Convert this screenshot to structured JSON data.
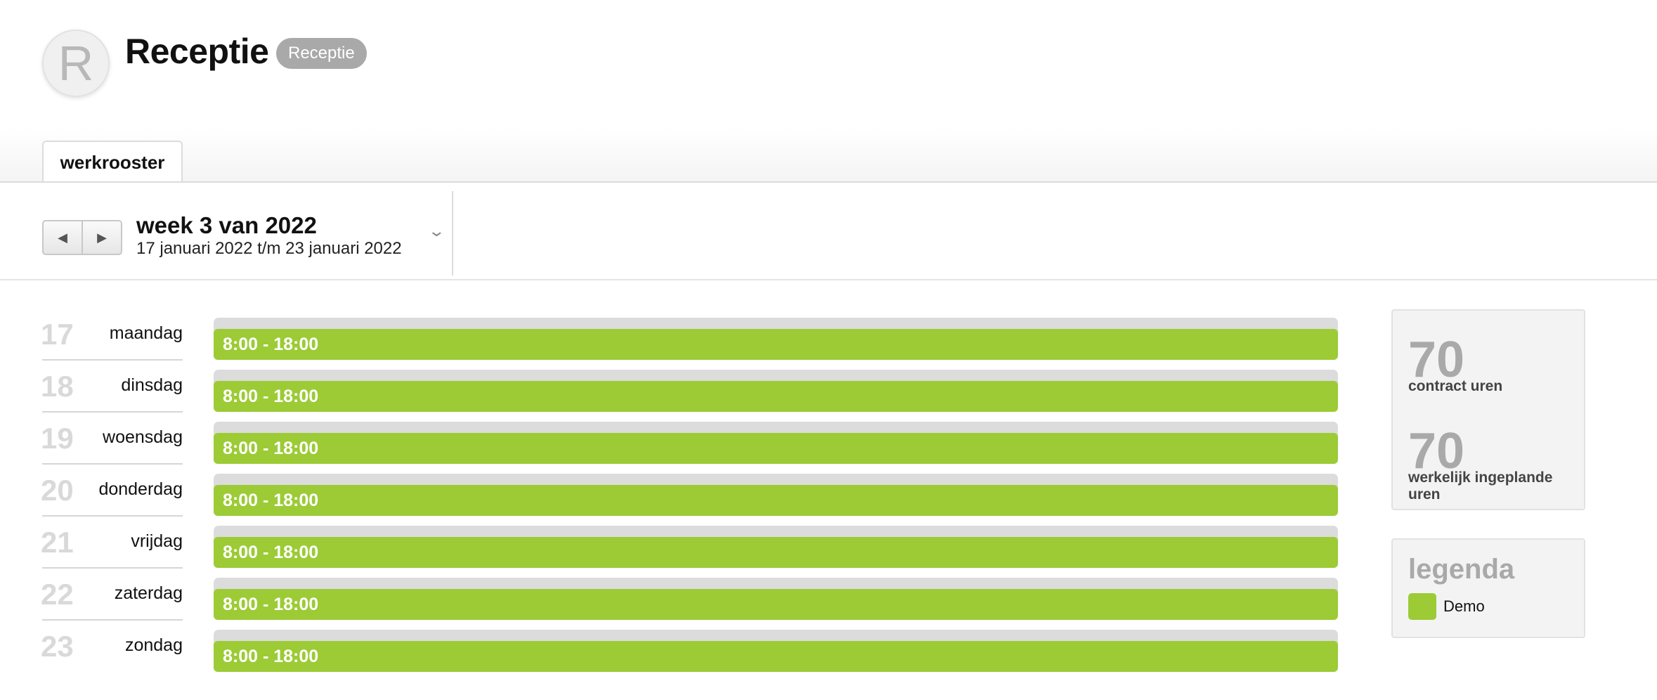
{
  "header": {
    "avatar_letter": "R",
    "title": "Receptie",
    "badge": "Receptie"
  },
  "tabs": [
    {
      "label": "werkrooster",
      "active": true
    }
  ],
  "week": {
    "prev_icon": "triangle-left-icon",
    "next_icon": "triangle-right-icon",
    "title": "week 3 van 2022",
    "range": "17 januari 2022 t/m 23 januari 2022",
    "dropdown_icon": "chevron-down-icon"
  },
  "days": [
    {
      "num": "17",
      "name": "maandag",
      "shift": "8:00 - 18:00"
    },
    {
      "num": "18",
      "name": "dinsdag",
      "shift": "8:00 - 18:00"
    },
    {
      "num": "19",
      "name": "woensdag",
      "shift": "8:00 - 18:00"
    },
    {
      "num": "20",
      "name": "donderdag",
      "shift": "8:00 - 18:00"
    },
    {
      "num": "21",
      "name": "vrijdag",
      "shift": "8:00 - 18:00"
    },
    {
      "num": "22",
      "name": "zaterdag",
      "shift": "8:00 - 18:00"
    },
    {
      "num": "23",
      "name": "zondag",
      "shift": "8:00 - 18:00"
    }
  ],
  "stats": {
    "contract_hours": "70",
    "contract_label": "contract uren",
    "planned_hours": "70",
    "planned_label": "werkelijk ingeplande uren"
  },
  "legend": {
    "title": "legenda",
    "items": [
      {
        "label": "Demo",
        "color": "#9ccb36"
      }
    ]
  },
  "colors": {
    "shift_bar": "#9ccb36",
    "track": "#dcdcdc",
    "badge": "#a9a9a9"
  }
}
